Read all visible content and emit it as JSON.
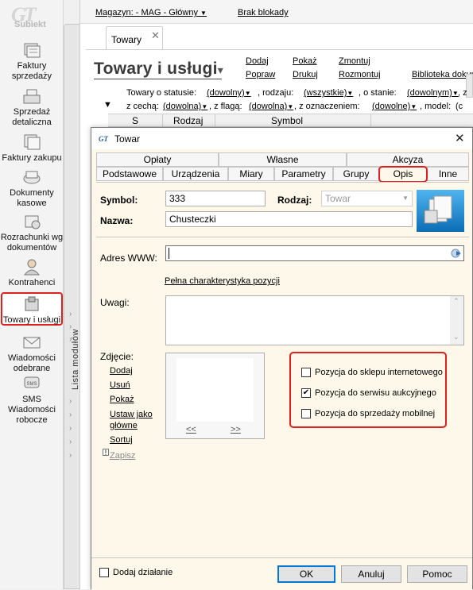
{
  "app": {
    "logo_text": "Subiekt",
    "sidebar": [
      {
        "label": "Faktury sprzedaży",
        "icon": "invoice-stack-icon"
      },
      {
        "label": "Sprzedaż detaliczna",
        "icon": "cash-register-icon"
      },
      {
        "label": "Faktury zakupu",
        "icon": "purchase-invoice-icon"
      },
      {
        "label": "Dokumenty kasowe",
        "icon": "cash-documents-icon"
      },
      {
        "label": "Rozrachunki wg dokumentów",
        "icon": "settlements-icon"
      },
      {
        "label": "Kontrahenci",
        "icon": "contractor-person-icon"
      },
      {
        "label": "Towary i usługi",
        "icon": "goods-box-icon"
      },
      {
        "label": "Wiadomości odebrane",
        "icon": "mail-received-icon"
      },
      {
        "label": "SMS Wiadomości robocze",
        "icon": "sms-icon"
      }
    ],
    "sidebar_selected_index": 6,
    "module_strip_label": "Lista modułów"
  },
  "topbar": {
    "warehouse": "Magazyn: - MAG - Główny",
    "lock": "Brak blokady"
  },
  "doc_tab": {
    "label": "Towary"
  },
  "list": {
    "title": "Towary i usługi",
    "actions": [
      "Dodaj",
      "Pokaż",
      "Zmontuj",
      "Popraw",
      "Drukuj",
      "Rozmontuj",
      "Biblioteka dokum"
    ],
    "filters": {
      "status_label": "Towary o statusie:",
      "status_value": "(dowolny)",
      "type_label": ", rodzaju:",
      "type_value": "(wszystkie)",
      "state_label": ", o stanie:",
      "state_value": "(dowolnym)",
      "state_tail": ", z",
      "feature_label": "z cechą:",
      "feature_value": "(dowolna)",
      "flag_label": ", z flagą:",
      "flag_value": "(dowolna)",
      "mark_label": ", z oznaczeniem:",
      "mark_value": "(dowolne)",
      "model_label": ", model:",
      "model_tail": "(c"
    },
    "columns": [
      "S",
      "Rodzaj",
      "Symbol"
    ]
  },
  "dialog": {
    "title": "Towar",
    "tabs_row1": [
      "Opłaty",
      "Własne",
      "Akcyza"
    ],
    "tabs_row2": [
      "Podstawowe",
      "Urządzenia",
      "Miary",
      "Parametry",
      "Grupy",
      "Opis",
      "Inne"
    ],
    "active_tab": "Opis",
    "symbol_label": "Symbol:",
    "symbol_value": "333",
    "rodzaj_label": "Rodzaj:",
    "rodzaj_value": "Towar",
    "nazwa_label": "Nazwa:",
    "nazwa_value": "Chusteczki",
    "www_label": "Adres WWW:",
    "www_value": "",
    "full_desc_link": "Pełna charakterystyka pozycji",
    "uwagi_label": "Uwagi:",
    "uwagi_value": "",
    "photo_label": "Zdjęcie:",
    "photo_actions": [
      "Dodaj",
      "Usuń",
      "Pokaż",
      "Ustaw jako główne",
      "Sortuj",
      "Zapisz"
    ],
    "photo_prev": "<<",
    "photo_next": ">>",
    "checkboxes": [
      {
        "label": "Pozycja do sklepu internetowego",
        "checked": false
      },
      {
        "label": "Pozycja do serwisu aukcyjnego",
        "checked": true
      },
      {
        "label": "Pozycja do sprzedaży mobilnej",
        "checked": false
      }
    ],
    "add_action_label": "Dodaj działanie",
    "add_action_checked": false,
    "buttons": {
      "ok": "OK",
      "cancel": "Anuluj",
      "help": "Pomoc"
    }
  },
  "colors": {
    "highlight": "#e0201c",
    "dialog_bg": "#fdf8ea",
    "focus_blue": "#0078d7"
  }
}
